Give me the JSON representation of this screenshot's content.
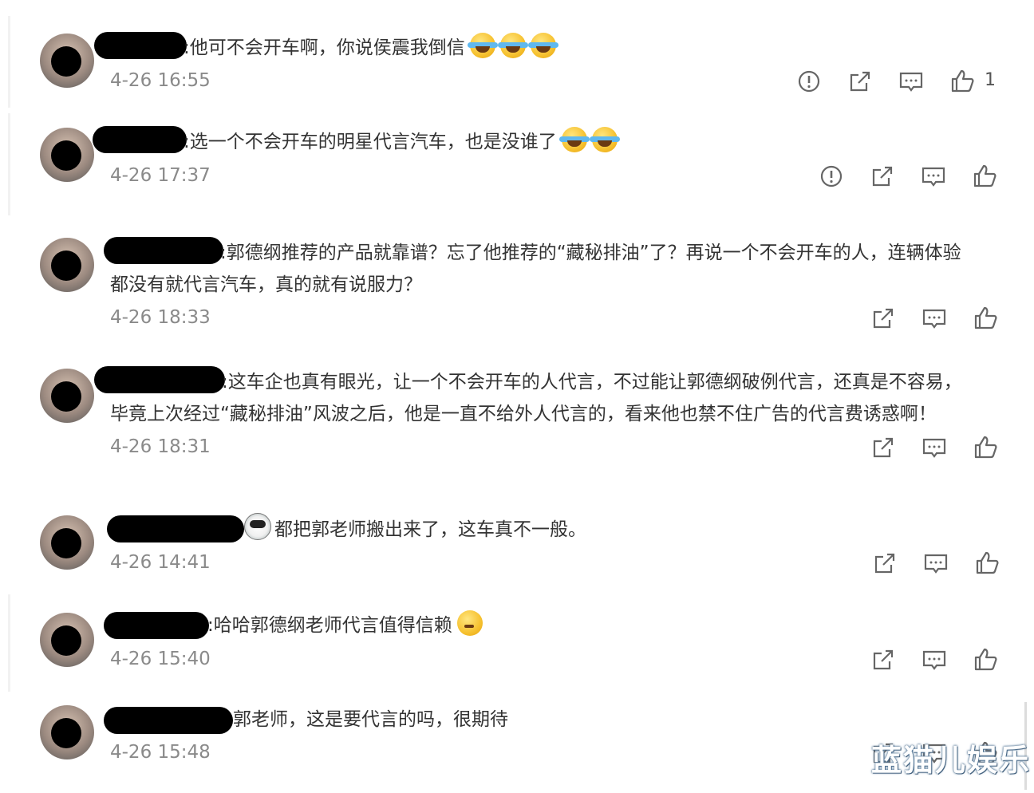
{
  "comments": [
    {
      "text": ":他可不会开车啊，你说侯震我倒信",
      "time": "4-26 16:55",
      "likes": "1",
      "emojis": 3
    },
    {
      "text": ":选一个不会开车的明星代言汽车，也是没谁了",
      "time": "4-26 17:37",
      "likes": "",
      "emojis": 2
    },
    {
      "text1": ":郭德纲推荐的产品就靠谱？忘了他推荐的“藏秘排油”了？再说一个不会开车的人，连辆体验",
      "text2": "都没有就代言汽车，真的就有说服力？",
      "time": "4-26 18:33"
    },
    {
      "text1": ":这车企也真有眼光，让一个不会开车的人代言，不过能让郭德纲破例代言，还真是不容易，",
      "text2": "毕竟上次经过“藏秘排油”风波之后，他是一直不给外人代言的，看来他也禁不住广告的代言费诱惑啊！",
      "time": "4-26 18:31"
    },
    {
      "text": "都把郭老师搬出来了，这车真不一般。",
      "time": "4-26 14:41"
    },
    {
      "text": ":哈哈郭德纲老师代言值得信赖",
      "time": "4-26 15:40"
    },
    {
      "text": "郭老师，这是要代言的吗，很期待",
      "time": "4-26 15:48"
    }
  ],
  "watermark": "蓝猫儿娱乐",
  "icons": [
    "report-icon",
    "share-icon",
    "comment-icon",
    "like-icon"
  ],
  "colors": {
    "text": "#333333",
    "time": "#8a8a8a",
    "icon": "#666666"
  }
}
